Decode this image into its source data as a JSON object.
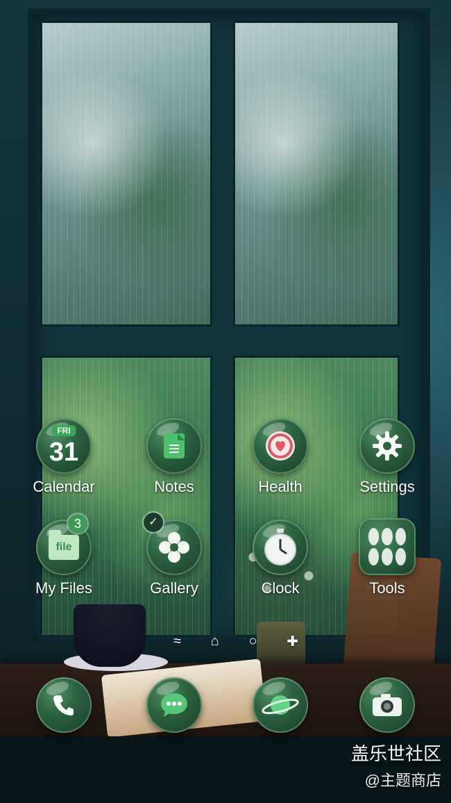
{
  "apps": {
    "calendar": {
      "label": "Calendar",
      "day": "FRI",
      "date": "31"
    },
    "notes": {
      "label": "Notes"
    },
    "health": {
      "label": "Health"
    },
    "settings": {
      "label": "Settings"
    },
    "my_files": {
      "label": "My Files",
      "badge": "3",
      "icon_text": "file"
    },
    "gallery": {
      "label": "Gallery",
      "check": "✓"
    },
    "clock": {
      "label": "Clock"
    },
    "tools": {
      "label": "Tools"
    }
  },
  "dock": [
    {
      "name": "phone-app",
      "icon": "phone-icon"
    },
    {
      "name": "messages-app",
      "icon": "chat-bubble-icon"
    },
    {
      "name": "internet-app",
      "icon": "planet-icon"
    },
    {
      "name": "camera-app",
      "icon": "camera-icon"
    }
  ],
  "pager": {
    "icons": [
      "lines-icon",
      "home-icon",
      "circle-icon",
      "plus-icon"
    ]
  },
  "watermark": {
    "line1": "盖乐世社区",
    "line2": "@主题商店"
  },
  "colors": {
    "bubble": "#2c6340",
    "accent": "#3aa85a",
    "badge": "#3f9a58"
  }
}
